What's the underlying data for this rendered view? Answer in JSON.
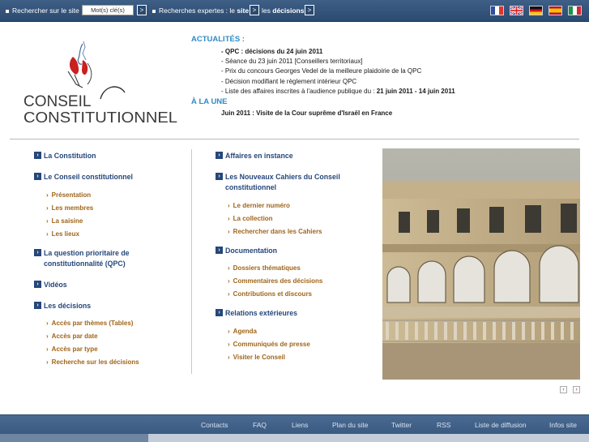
{
  "topbar": {
    "search_site_label": "Rechercher sur le site",
    "keywords_placeholder": "Mot(s) clé(s)",
    "go": ">",
    "expert_prefix": "Recherches expertes : ",
    "expert_le": "le",
    "expert_site": "site",
    "expert_les": "les",
    "expert_decisions": "décisions"
  },
  "flags": [
    "fr-flag",
    "uk-flag",
    "de-flag",
    "es-flag",
    "it-flag"
  ],
  "logo": {
    "line1": "CONSEIL",
    "line2": "CONSTITUTIONNEL"
  },
  "actualites": {
    "heading": "ACTUALITÉS :",
    "items": [
      "- QPC : décisions du 24 juin 2011",
      "- Séance du 23 juin 2011 [Conseillers territoriaux]",
      "- Prix du concours Georges Vedel de la meilleure plaidoirie de la QPC",
      "- Décision modifiant le règlement intérieur QPC",
      "- Liste des affaires inscrites à l'audience publique du : "
    ],
    "last_bold": "21 juin 2011 - 14 juin 2011"
  },
  "une": {
    "heading": "À LA UNE",
    "text": "Juin 2011 : Visite de la Cour suprême d'Israël en France"
  },
  "left_menu": {
    "constitution": "La Constitution",
    "conseil": "Le Conseil constitutionnel",
    "presentation": "Présentation",
    "membres": "Les membres",
    "saisine": "La saisine",
    "lieux": "Les lieux",
    "qpc": "La question prioritaire de constitutionnalité (QPC)",
    "videos": "Vidéos",
    "decisions": "Les décisions",
    "themes": "Accès par thèmes (Tables)",
    "date": "Accès par date",
    "type": "Accès par type",
    "recherche": "Recherche sur les décisions"
  },
  "mid_menu": {
    "affaires": "Affaires en instance",
    "cahiers": "Les Nouveaux Cahiers du Conseil constitutionnel",
    "dernier": "Le dernier numéro",
    "collection": "La collection",
    "rechercher": "Rechercher dans les Cahiers",
    "documentation": "Documentation",
    "dossiers": "Dossiers thématiques",
    "commentaires": "Commentaires des décisions",
    "contributions": "Contributions et discours",
    "relations": "Relations extérieures",
    "agenda": "Agenda",
    "communiques": "Communiqués de presse",
    "visiter": "Visiter le Conseil"
  },
  "slider": {
    "prev": "‹",
    "next": "›"
  },
  "footer": [
    "Contacts",
    "FAQ",
    "Liens",
    "Plan du site",
    "Twitter",
    "RSS",
    "Liste de diffusion",
    "Infos site"
  ]
}
